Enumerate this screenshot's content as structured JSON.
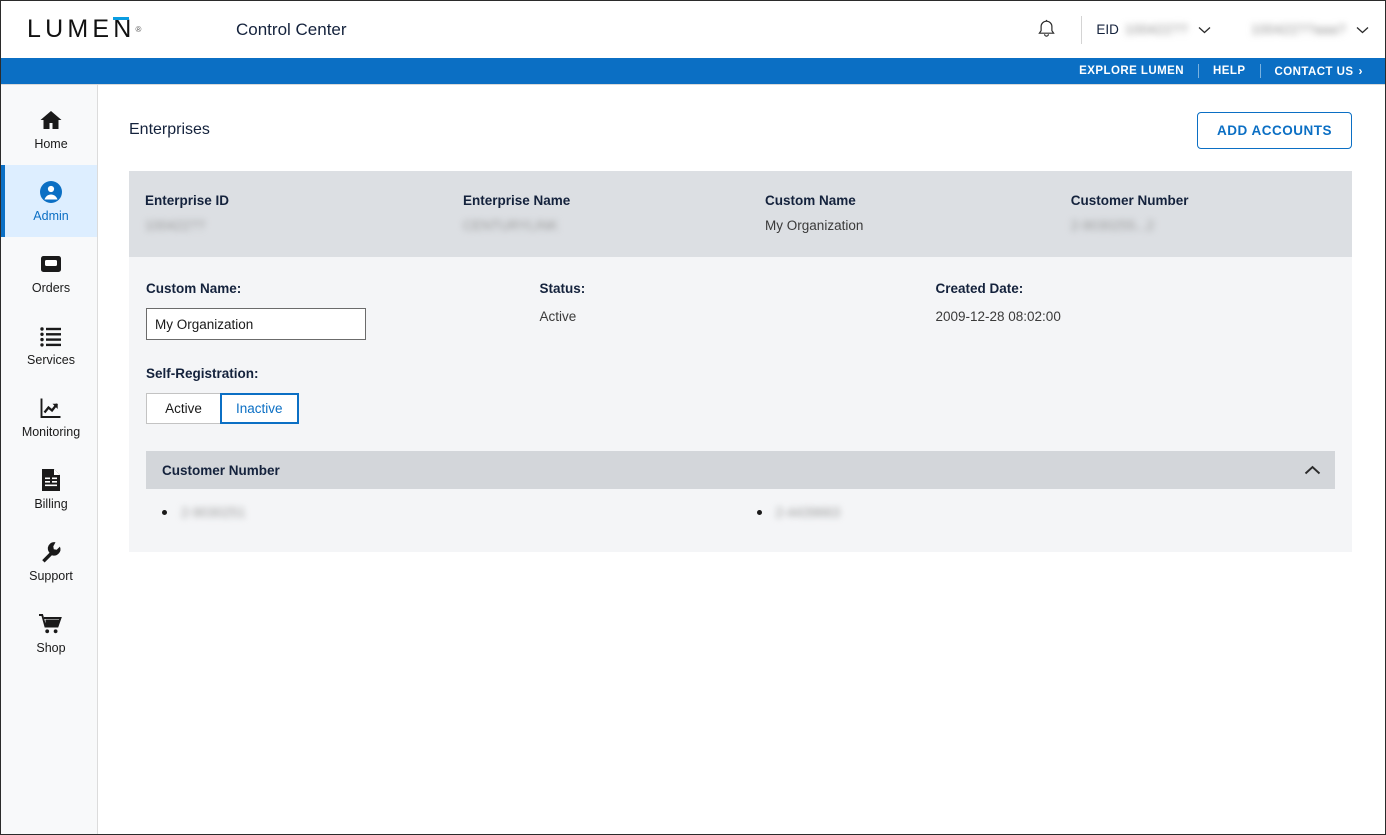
{
  "header": {
    "logo_text": "LUMEN",
    "logo_registered": "®",
    "app_title": "Control Center",
    "bell_icon": "notification-bell-icon",
    "eid_label": "EID",
    "eid_value": "100422??",
    "account_value": "100422??aaa?",
    "caret_icon": "chevron-down-icon"
  },
  "utility_bar": {
    "links": [
      {
        "label": "EXPLORE LUMEN",
        "has_chevron": false
      },
      {
        "label": "HELP",
        "has_chevron": false
      },
      {
        "label": "CONTACT US",
        "has_chevron": true
      }
    ],
    "chevron": "›"
  },
  "sidebar": {
    "items": [
      {
        "label": "Home",
        "icon": "home-icon",
        "active": false
      },
      {
        "label": "Admin",
        "icon": "user-circle-icon",
        "active": true
      },
      {
        "label": "Orders",
        "icon": "inbox-tray-icon",
        "active": false
      },
      {
        "label": "Services",
        "icon": "list-icon",
        "active": false
      },
      {
        "label": "Monitoring",
        "icon": "chart-line-icon",
        "active": false
      },
      {
        "label": "Billing",
        "icon": "invoice-icon",
        "active": false
      },
      {
        "label": "Support",
        "icon": "wrench-icon",
        "active": false
      },
      {
        "label": "Shop",
        "icon": "cart-icon",
        "active": false
      }
    ]
  },
  "main": {
    "page_title": "Enterprises",
    "add_accounts_label": "ADD ACCOUNTS",
    "summary": {
      "columns": [
        {
          "label": "Enterprise ID",
          "value": "100422??",
          "redacted": true
        },
        {
          "label": "Enterprise Name",
          "value": "CENTURYLINK",
          "redacted": true
        },
        {
          "label": "Custom Name",
          "value": "My Organization",
          "redacted": false
        },
        {
          "label": "Customer Number",
          "value": "2-9030255...2",
          "redacted": true
        }
      ]
    },
    "form": {
      "custom_name_label": "Custom Name:",
      "custom_name_value": "My Organization",
      "status_label": "Status:",
      "status_value": "Active",
      "created_date_label": "Created Date:",
      "created_date_value": "2009-12-28 08:02:00",
      "self_registration_label": "Self-Registration:",
      "self_registration_options": [
        {
          "label": "Active",
          "selected": false
        },
        {
          "label": "Inactive",
          "selected": true
        }
      ]
    },
    "accordion": {
      "title": "Customer Number",
      "chevron_icon": "chevron-up-icon",
      "expanded": true,
      "items": [
        {
          "value": "2-9030251",
          "redacted": true
        },
        {
          "value": "2-4439663",
          "redacted": true
        }
      ]
    }
  },
  "colors": {
    "brand_blue": "#0b6fc4",
    "logo_accent": "#0b9de1",
    "active_nav_bg": "#ddeeff",
    "card_head_bg": "#dcdfe3",
    "card_body_bg": "#f4f5f7",
    "accordion_head_bg": "#d3d6da"
  }
}
